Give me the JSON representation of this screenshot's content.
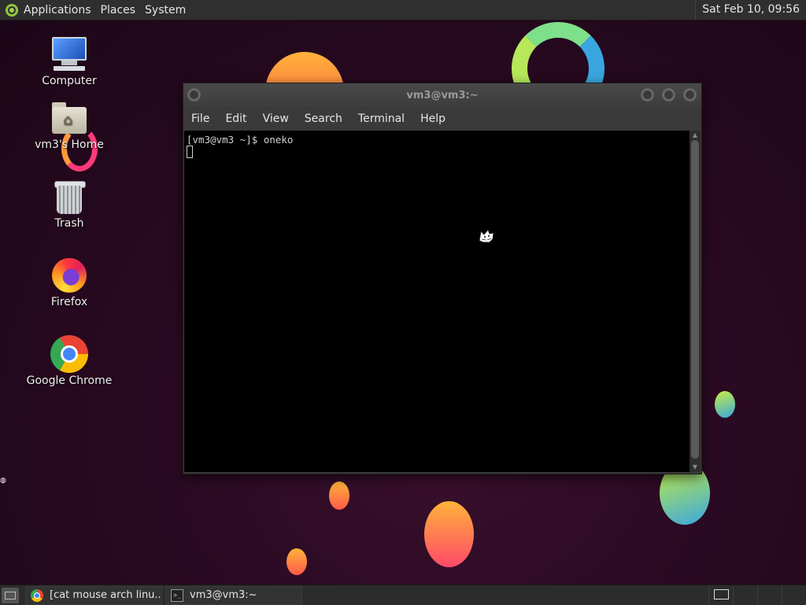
{
  "top_panel": {
    "menus": [
      "Applications",
      "Places",
      "System"
    ],
    "clock": "Sat Feb 10, 09:56"
  },
  "desktop_icons": [
    {
      "label": "Computer",
      "icon": "computer-icon"
    },
    {
      "label": "vm3's Home",
      "icon": "home-folder-icon"
    },
    {
      "label": "Trash",
      "icon": "trash-icon"
    },
    {
      "label": "Firefox",
      "icon": "firefox-icon"
    },
    {
      "label": "Google Chrome",
      "icon": "chrome-icon"
    }
  ],
  "terminal": {
    "title": "vm3@vm3:~",
    "menus": [
      "File",
      "Edit",
      "View",
      "Search",
      "Terminal",
      "Help"
    ],
    "prompt_line": "[vm3@vm3 ~]$ oneko"
  },
  "taskbar": {
    "tasks": [
      {
        "label": "[cat mouse arch linu...",
        "icon": "chrome-icon"
      },
      {
        "label": "vm3@vm3:~",
        "icon": "terminal-icon"
      }
    ]
  },
  "colors": {
    "panel": "#2f2f2f",
    "terminal_bg": "#000000",
    "terminal_fg": "#d0d0d0",
    "desktop_bg": "#2a0a22"
  }
}
